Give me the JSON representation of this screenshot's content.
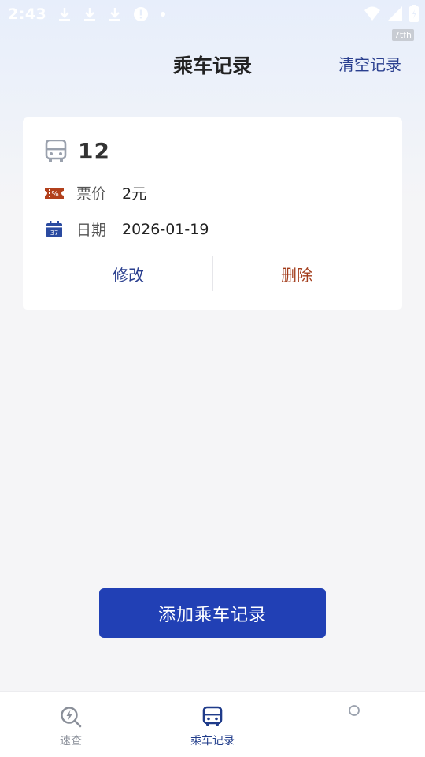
{
  "status_bar": {
    "time": "2:43",
    "watermark": "7tfh"
  },
  "header": {
    "title": "乘车记录",
    "clear_label": "清空记录"
  },
  "record": {
    "route_number": "12",
    "fare_label": "票价",
    "fare_value": "2元",
    "date_label": "日期",
    "date_value": "2026-01-19",
    "edit_label": "修改",
    "delete_label": "删除"
  },
  "add_button_label": "添加乘车记录",
  "bottom_nav": {
    "items": [
      {
        "label": "速查",
        "icon": "quick-search-icon",
        "active": false
      },
      {
        "label": "乘车记录",
        "icon": "bus-icon",
        "active": true
      },
      {
        "label": "",
        "icon": "circle-icon",
        "active": false
      }
    ]
  },
  "colors": {
    "accent": "#2140b5",
    "nav_active": "#1f3b8a",
    "delete": "#a33d1c",
    "fare_icon": "#b2401c"
  }
}
